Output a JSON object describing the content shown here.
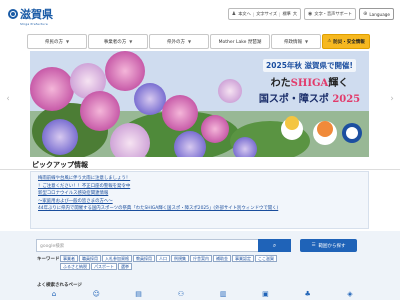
{
  "header": {
    "logo_text": "滋賀県",
    "logo_sub": "Shiga Prefecture",
    "text_size_label": "本文へ",
    "font_size_label": "文字サイズ",
    "font_standard": "標準",
    "font_large": "大",
    "support_label": "文字・音声サポート",
    "language_label": "Language"
  },
  "nav": {
    "items": [
      {
        "label": "県民の方"
      },
      {
        "label": "事業者の方"
      },
      {
        "label": "県外の方"
      },
      {
        "label": "Mother Lake 琵琶湖"
      },
      {
        "label": "県政情報"
      },
      {
        "label": "防災・安全情報"
      }
    ]
  },
  "hero": {
    "line1": "2025年秋 滋賀県で開催!",
    "line2_pre": "わた",
    "line2_shiga": "SHIGA",
    "line2_post": "輝く",
    "line3_pre": "国スポ・障スポ",
    "line3_year": "2025"
  },
  "pickup": {
    "title": "ピックアップ情報",
    "items": [
      "梅雨前線や台風に伴う大雨に注意しましょう！",
      "！ご注意ください！！不正口座の警報を発令中",
      "新型コロナウイルス感染症関連情報",
      "～家庭用および一般の皆さまの方へ～",
      "44年ぶりに県内で開催する国内スポーツの祭典「わたSHIGA輝く国スポ・障スポ2025」(外部サイト別ウィンドウで開く)"
    ]
  },
  "search": {
    "placeholder": "google検索",
    "keyword_label": "キーワード",
    "keywords": [
      "事業者",
      "職員採用",
      "入札参加資格",
      "教員採用",
      "人口",
      "例規集",
      "庁舎案内",
      "補助金",
      "事業認定",
      "ここ滋賀",
      "ふるさと納税",
      "パスポート",
      "選挙"
    ],
    "howto_label": "範囲から探す",
    "often_label": "よく検索されるページ"
  },
  "colors": {
    "brand": "#1a5ba6",
    "safety": "#f6b820",
    "search_button": "#1f63b8"
  }
}
